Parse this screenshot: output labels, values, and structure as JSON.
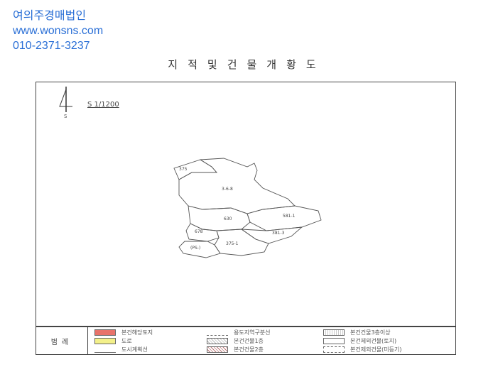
{
  "watermark": {
    "name": "여의주경매법인",
    "url": "www.wonsns.com",
    "phone": "010-2371-3237"
  },
  "document": {
    "title": "지적및건물개황도",
    "scale": "S 1/1200",
    "north_label": "S"
  },
  "parcels": [
    "375",
    "3-6-8",
    "630",
    "581-1",
    "678",
    "381-3",
    "375-1",
    "(PS-)"
  ],
  "legend": {
    "title": "범례",
    "items": [
      {
        "label": "본건해당토지",
        "color": "#e8736a"
      },
      {
        "label": "도로",
        "color": "#f3f08a"
      },
      {
        "label": "도시계획선",
        "color": "#ffffff"
      },
      {
        "label": "용도지역구분선",
        "color": "#ffffff"
      },
      {
        "label": "본건건물1층",
        "color": "#ffffff"
      },
      {
        "label": "본건건물2층",
        "color": "#ffffff"
      },
      {
        "label": "본건건물3층이상",
        "color": "#ffffff"
      },
      {
        "label": "본건제외건물(토지)",
        "color": "#ffffff"
      },
      {
        "label": "본건제외건물(미등기)",
        "color": "#ffffff"
      }
    ]
  }
}
